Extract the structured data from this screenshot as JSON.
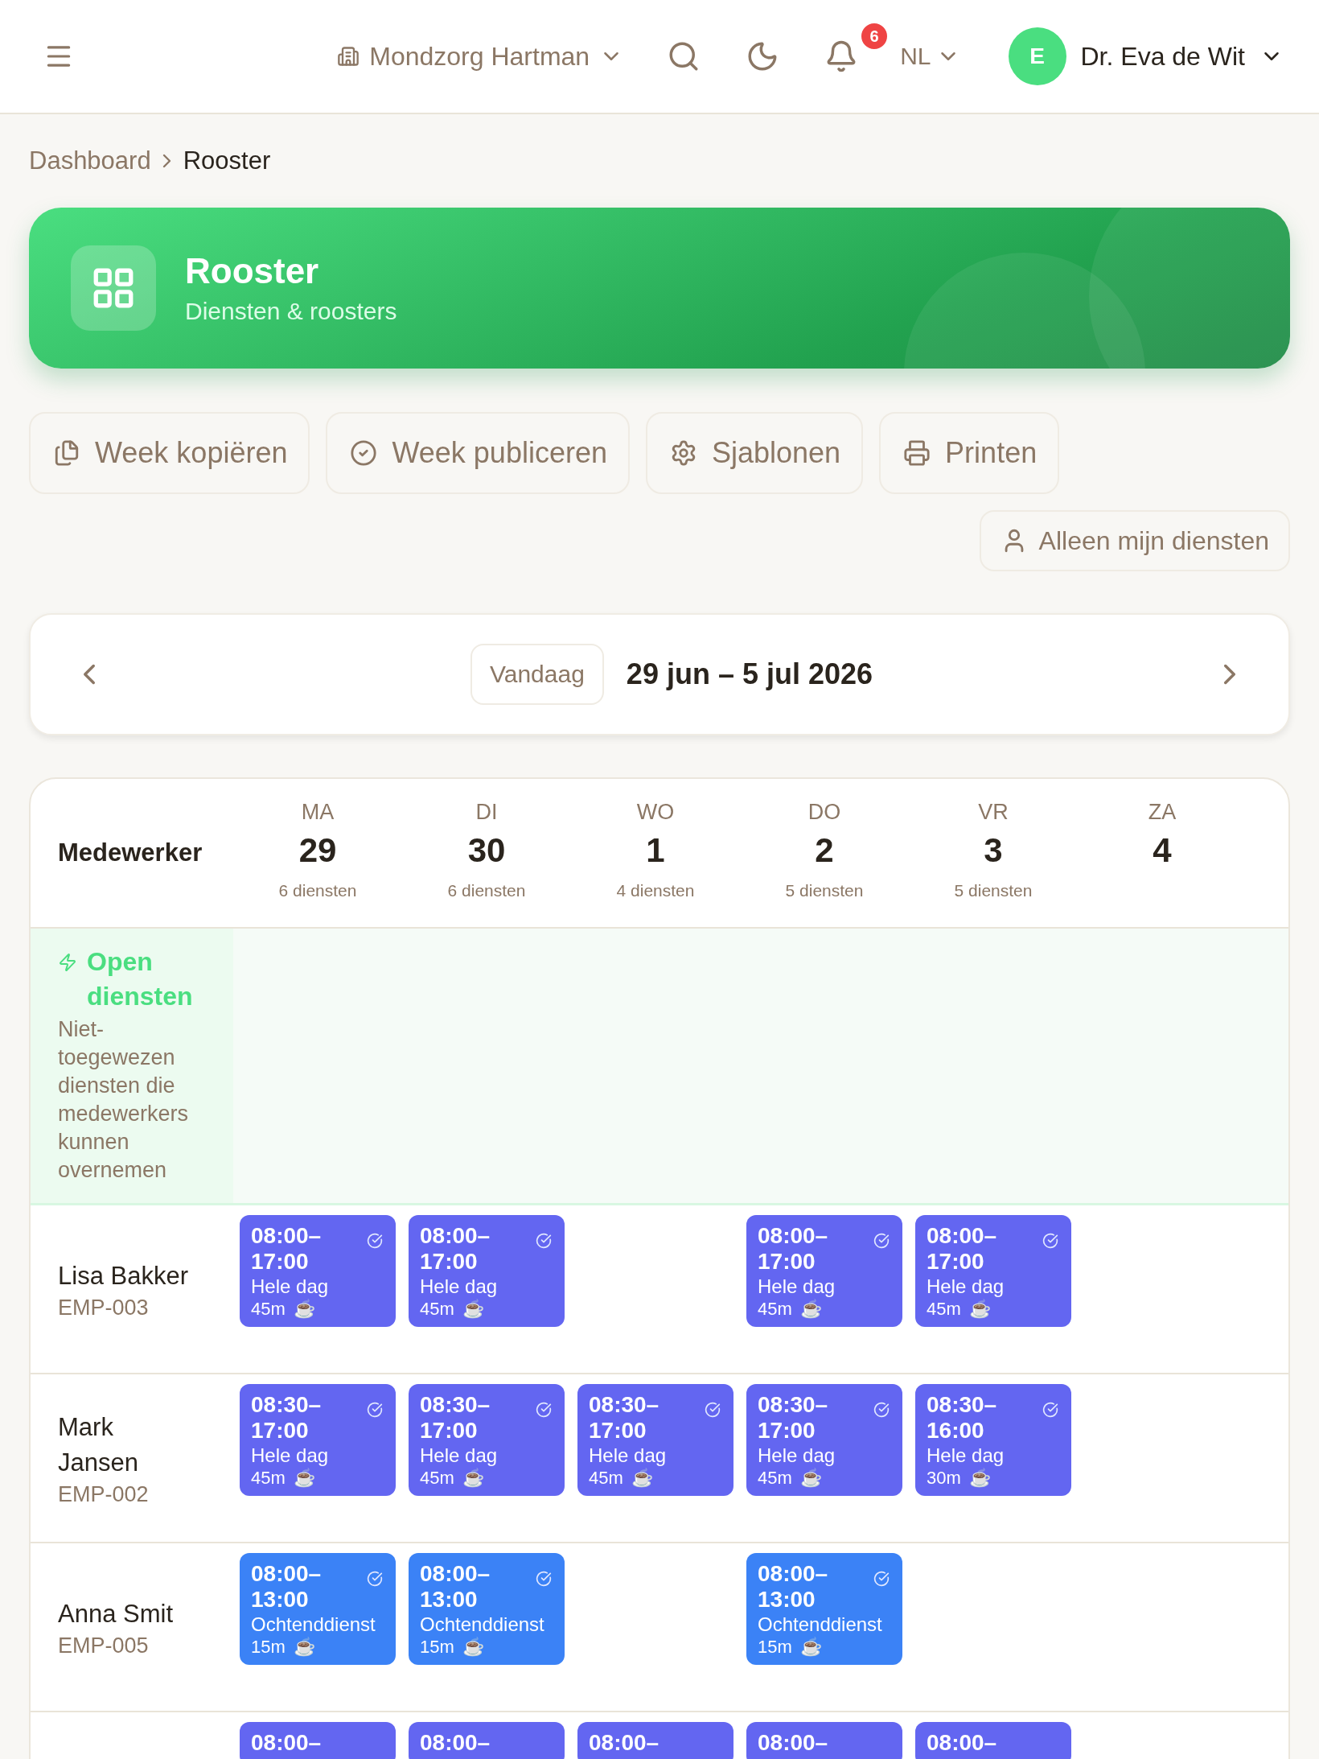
{
  "topbar": {
    "organization": "Mondzorg Hartman",
    "notification_count": "6",
    "language": "NL",
    "user": {
      "initial": "E",
      "name": "Dr. Eva de Wit"
    }
  },
  "breadcrumb": [
    {
      "label": "Dashboard",
      "current": false
    },
    {
      "label": "Rooster",
      "current": true
    }
  ],
  "hero": {
    "title": "Rooster",
    "subtitle": "Diensten & roosters"
  },
  "actions": [
    {
      "kind": "copy",
      "label": "Week kopiëren"
    },
    {
      "kind": "publish",
      "label": "Week publiceren"
    },
    {
      "kind": "templates",
      "label": "Sjablonen"
    },
    {
      "kind": "print",
      "label": "Printen"
    }
  ],
  "filter": {
    "label": "Alleen mijn diensten",
    "selected": false
  },
  "week_nav": {
    "today": "Vandaag",
    "range": "29 jun – 5 jul 2026"
  },
  "table": {
    "employee_heading": "Medewerker",
    "days": [
      {
        "weekday": "MA",
        "date": "29",
        "count": "6 diensten"
      },
      {
        "weekday": "DI",
        "date": "30",
        "count": "6 diensten"
      },
      {
        "weekday": "WO",
        "date": "1",
        "count": "4 diensten"
      },
      {
        "weekday": "DO",
        "date": "2",
        "count": "5 diensten"
      },
      {
        "weekday": "VR",
        "date": "3",
        "count": "5 diensten"
      },
      {
        "weekday": "ZA",
        "date": "4"
      }
    ],
    "open_shifts": {
      "title": "Open diensten",
      "description": "Niet-toegewezen diensten die medewerkers kunnen overnemen"
    },
    "rows": [
      {
        "name": "Lisa Bakker",
        "code": "EMP-003",
        "cells": [
          {
            "kind": "shift",
            "time": "08:00–17:00",
            "type": "Hele dag",
            "break": "45m",
            "break_icon": "☕",
            "color": "#6366f1",
            "published": true
          },
          {
            "kind": "shift",
            "time": "08:00–17:00",
            "type": "Hele dag",
            "break": "45m",
            "break_icon": "☕",
            "color": "#6366f1",
            "published": true
          },
          {
            "kind": "empty"
          },
          {
            "kind": "shift",
            "time": "08:00–17:00",
            "type": "Hele dag",
            "break": "45m",
            "break_icon": "☕",
            "color": "#6366f1",
            "published": true
          },
          {
            "kind": "shift",
            "time": "08:00–17:00",
            "type": "Hele dag",
            "break": "45m",
            "break_icon": "☕",
            "color": "#6366f1",
            "published": true
          },
          {
            "kind": "empty"
          }
        ]
      },
      {
        "name": "Mark Jansen",
        "code": "EMP-002",
        "cells": [
          {
            "kind": "shift",
            "time": "08:30–17:00",
            "type": "Hele dag",
            "break": "45m",
            "break_icon": "☕",
            "color": "#6366f1",
            "published": true
          },
          {
            "kind": "shift",
            "time": "08:30–17:00",
            "type": "Hele dag",
            "break": "45m",
            "break_icon": "☕",
            "color": "#6366f1",
            "published": true
          },
          {
            "kind": "shift",
            "time": "08:30–17:00",
            "type": "Hele dag",
            "break": "45m",
            "break_icon": "☕",
            "color": "#6366f1",
            "published": true
          },
          {
            "kind": "shift",
            "time": "08:30–17:00",
            "type": "Hele dag",
            "break": "45m",
            "break_icon": "☕",
            "color": "#6366f1",
            "published": true
          },
          {
            "kind": "shift",
            "time": "08:30–16:00",
            "type": "Hele dag",
            "break": "30m",
            "break_icon": "☕",
            "color": "#6366f1",
            "published": true
          },
          {
            "kind": "empty"
          }
        ]
      },
      {
        "name": "Anna Smit",
        "code": "EMP-005",
        "cells": [
          {
            "kind": "shift",
            "time": "08:00–13:00",
            "type": "Ochtenddienst",
            "break": "15m",
            "break_icon": "☕",
            "color": "#3b82f6",
            "published": true
          },
          {
            "kind": "shift",
            "time": "08:00–13:00",
            "type": "Ochtenddienst",
            "break": "15m",
            "break_icon": "☕",
            "color": "#3b82f6",
            "published": true
          },
          {
            "kind": "empty"
          },
          {
            "kind": "shift",
            "time": "08:00–13:00",
            "type": "Ochtenddienst",
            "break": "15m",
            "break_icon": "☕",
            "color": "#3b82f6",
            "published": true
          },
          {
            "kind": "empty"
          },
          {
            "kind": "empty"
          }
        ]
      },
      {
        "cells": [
          {
            "kind": "shift",
            "time": "08:00–",
            "color": "#6366f1"
          },
          {
            "kind": "shift",
            "time": "08:00–",
            "color": "#6366f1"
          },
          {
            "kind": "shift",
            "time": "08:00–",
            "color": "#6366f1"
          },
          {
            "kind": "shift",
            "time": "08:00–",
            "color": "#6366f1"
          },
          {
            "kind": "shift",
            "time": "08:00–",
            "color": "#6366f1"
          },
          {
            "kind": "empty"
          }
        ]
      }
    ]
  }
}
